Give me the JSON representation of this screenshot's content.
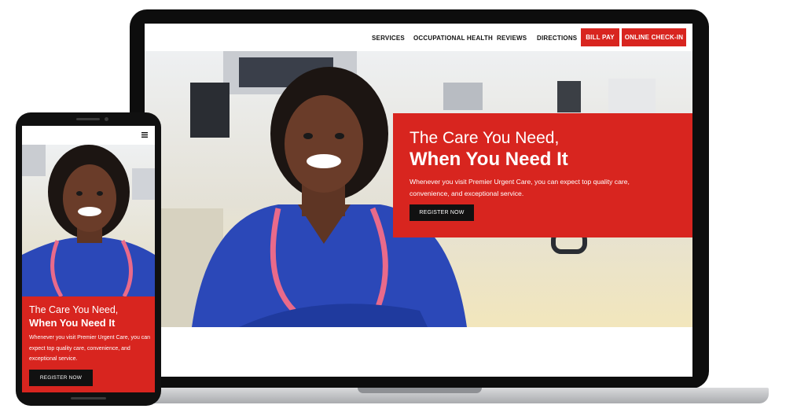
{
  "desktop": {
    "nav": {
      "links": [
        "SERVICES",
        "OCCUPATIONAL HEALTH",
        "REVIEWS",
        "DIRECTIONS"
      ],
      "buttons": [
        "BILL PAY",
        "ONLINE CHECK-IN"
      ]
    },
    "hero": {
      "headline_line1": "The Care You Need,",
      "headline_line2": "When You Need It",
      "body": "Whenever you visit Premier Urgent Care, you can expect top quality care, convenience, and exceptional service.",
      "cta": "REGISTER NOW"
    }
  },
  "mobile": {
    "menu_icon": "hamburger-menu-icon",
    "hero": {
      "headline_line1": "The Care You Need,",
      "headline_line2": "When You Need It",
      "body": "Whenever you visit Premier Urgent Care, you can expect top quality care, convenience, and exceptional service.",
      "cta": "REGISTER NOW"
    }
  },
  "colors": {
    "brand_red": "#d8251f",
    "scrubs_blue": "#2b48b8",
    "device_black": "#0d0d0d"
  }
}
